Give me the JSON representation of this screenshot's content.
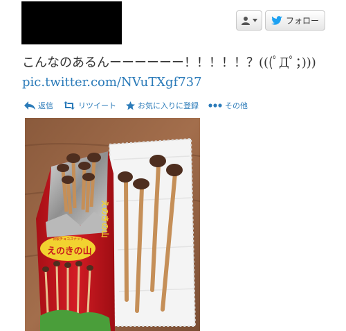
{
  "header": {
    "follow_label": "フォロー"
  },
  "tweet": {
    "text": "こんなのあるんーーーーーー！！！！！？(((ﾟДﾟ；)))",
    "link": "pic.twitter.com/NVuTXgf737"
  },
  "actions": [
    {
      "label": "返信",
      "icon": "reply-icon"
    },
    {
      "label": "リツイート",
      "icon": "retweet-icon"
    },
    {
      "label": "お気に入りに登録",
      "icon": "star-icon"
    },
    {
      "label": "その他",
      "icon": "more-icon"
    }
  ],
  "package": {
    "brand_text": "えのきの山",
    "side_text": "えのきの山",
    "small_text": "特製チョコスナック"
  },
  "colors": {
    "link": "#2b7bb9",
    "twitter_blue": "#1da1f2",
    "text": "#333333",
    "package_red": "#c8161d"
  }
}
